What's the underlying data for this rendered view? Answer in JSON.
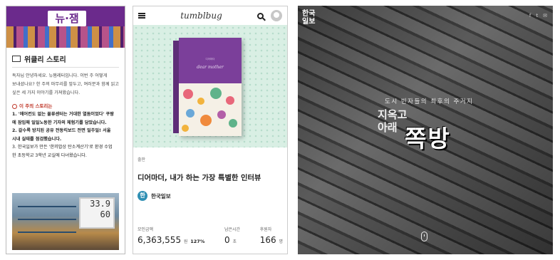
{
  "newsletter": {
    "logo": "뉴·잼",
    "section_title": "위클리 스토리",
    "intro": [
      "독자님 안녕하세요. 뉴잼레터입니다. 이번 주 어떻게",
      "보내셨나요? 한 주의 마무리를 앞두고, 여러분과 함께 읽고",
      "싶은 세 가지 이야기를 가져왔습니다."
    ],
    "stories_heading": "이 주의 스토리는",
    "items": [
      "1. '에어컨도 없는 물류센터는 거대한 열돔이었다' 쿠팡",
      "에 잠입해 일일노동한 기자의 체험기를 담았습니다.",
      "2. 갈수록 방치된 공유 전동킥보드 전면 일주일! 서울",
      "시내 실태를 점검했습니다.",
      "3. 한국일보가 만든 '한끼밥상 탄소계산기'로 환경 수업",
      "한 초등학교 3학년 교실에 다녀왔습니다."
    ],
    "thermo_top": "33.9",
    "thermo_bottom": "60"
  },
  "tumblbug": {
    "brand": "tumblbug",
    "book_small": "디어마더",
    "book_title": "dear mother",
    "category": "출판",
    "project_title": "디어마더, 내가 하는 가장 특별한 인터뷰",
    "creator": "한국일보",
    "creator_initial": "한",
    "stats": {
      "raised_label": "모인금액",
      "raised_value": "6,363,555",
      "raised_unit": "원",
      "raised_pct": "127%",
      "time_label": "남은시간",
      "time_value": "0",
      "time_unit": "초",
      "backers_label": "후원자",
      "backers_value": "166",
      "backers_unit": "명"
    }
  },
  "hankook": {
    "logo_line1": "한국",
    "logo_line2": "일보",
    "social": [
      "f",
      "t",
      "✉"
    ],
    "subtitle": "도시 빈자들의 최후의 주거지",
    "title_line1": "지옥고",
    "title_line2": "아래",
    "title_big": "쪽방"
  }
}
